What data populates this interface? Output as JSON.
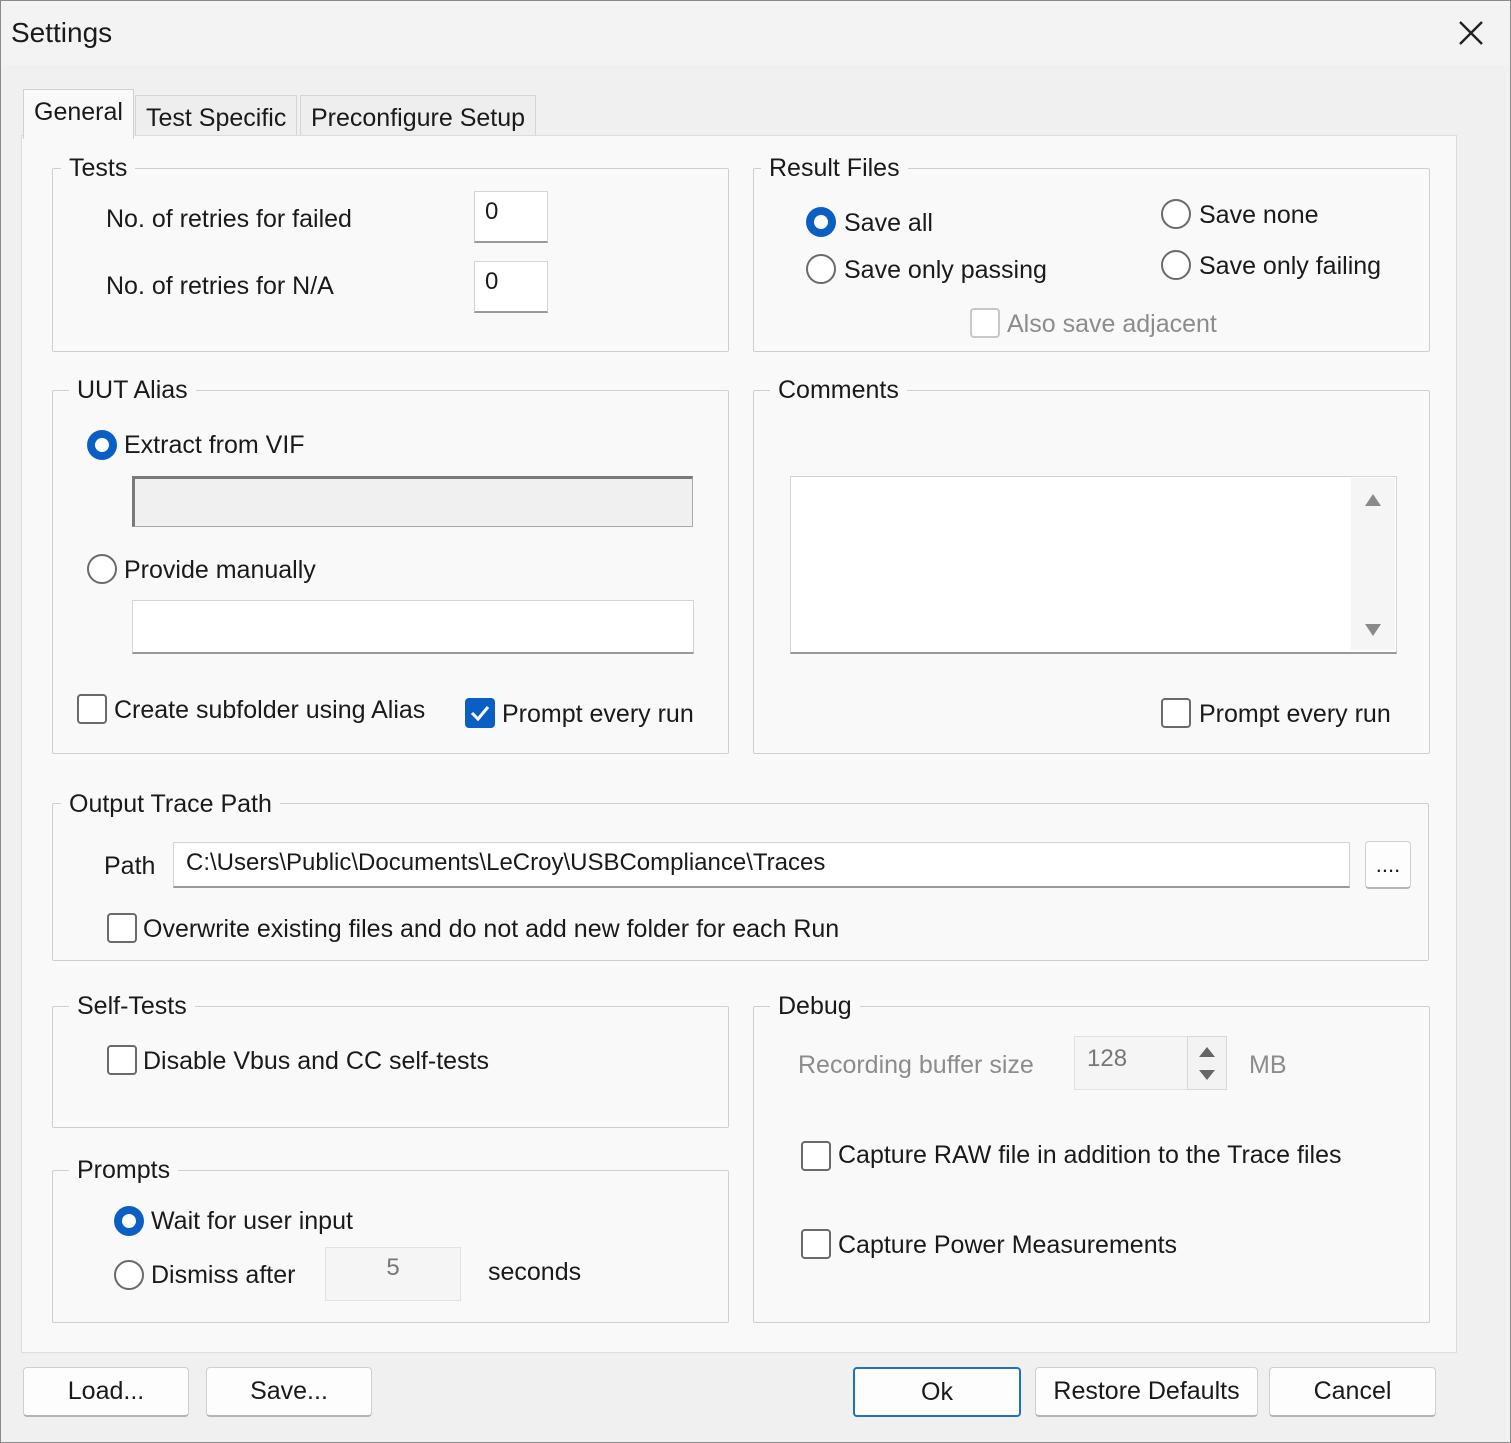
{
  "window": {
    "title": "Settings"
  },
  "tabs": [
    {
      "label": "General",
      "active": true
    },
    {
      "label": "Test Specific",
      "active": false
    },
    {
      "label": "Preconfigure Setup",
      "active": false
    }
  ],
  "tests": {
    "legend": "Tests",
    "retries_failed_label": "No. of retries for failed",
    "retries_failed_value": "0",
    "retries_na_label": "No. of retries for N/A",
    "retries_na_value": "0"
  },
  "result_files": {
    "legend": "Result Files",
    "save_all": "Save all",
    "save_none": "Save none",
    "save_only_passing": "Save only passing",
    "save_only_failing": "Save only failing",
    "also_save_adjacent": "Also save adjacent",
    "selected": "save_all"
  },
  "uut_alias": {
    "legend": "UUT Alias",
    "extract_from_vif": "Extract from VIF",
    "extract_value": "",
    "provide_manually": "Provide manually",
    "manual_value": "",
    "create_subfolder": "Create subfolder using Alias",
    "create_subfolder_checked": false,
    "prompt_every_run": "Prompt every run",
    "prompt_every_run_checked": true
  },
  "comments": {
    "legend": "Comments",
    "value": "",
    "prompt_every_run": "Prompt every run",
    "prompt_every_run_checked": false
  },
  "output_trace": {
    "legend": "Output Trace Path",
    "path_label": "Path",
    "path_value": "C:\\Users\\Public\\Documents\\LeCroy\\USBCompliance\\Traces",
    "browse_label": "....",
    "overwrite_label": "Overwrite existing files and do not add new folder for each Run",
    "overwrite_checked": false
  },
  "self_tests": {
    "legend": "Self-Tests",
    "disable_label": "Disable Vbus and CC self-tests",
    "disable_checked": false
  },
  "prompts": {
    "legend": "Prompts",
    "wait_label": "Wait for user input",
    "dismiss_label": "Dismiss after",
    "dismiss_value": "5",
    "seconds_label": "seconds",
    "selected": "wait"
  },
  "debug": {
    "legend": "Debug",
    "buffer_label": "Recording buffer size",
    "buffer_value": "128",
    "buffer_unit": "MB",
    "capture_raw": "Capture RAW file in addition to the Trace files",
    "capture_raw_checked": false,
    "capture_power": "Capture Power Measurements",
    "capture_power_checked": false
  },
  "buttons": {
    "load": "Load...",
    "save": "Save...",
    "ok": "Ok",
    "restore": "Restore Defaults",
    "cancel": "Cancel"
  },
  "colors": {
    "accent": "#0a5fc4",
    "background": "#f0f0f0",
    "panel": "#f9f9f9"
  }
}
